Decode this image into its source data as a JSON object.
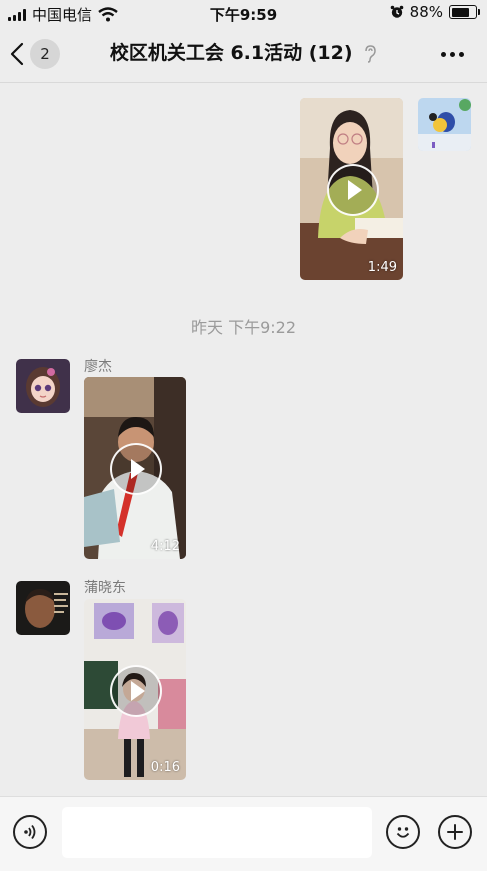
{
  "status_bar": {
    "carrier": "中国电信",
    "time": "下午9:59",
    "battery_text": "88%",
    "battery_level": 0.88,
    "icons": [
      "signal-icon",
      "wifi-icon",
      "alarm-icon",
      "battery-icon"
    ]
  },
  "nav": {
    "back_icon": "chevron-left-icon",
    "unread_count": "2",
    "title": "校区机关工会 6.1活动 (12)",
    "ear_icon": "earpiece-icon",
    "more_icon": "more-icon"
  },
  "messages": [
    {
      "type": "video",
      "side": "right",
      "duration": "1:49",
      "icon": "play-icon"
    },
    {
      "type": "timestamp",
      "text": "昨天 下午9:22"
    },
    {
      "type": "video",
      "side": "left",
      "sender": "廖杰",
      "duration": "4:12",
      "icon": "play-icon"
    },
    {
      "type": "video",
      "side": "left",
      "sender": "蒲晓东",
      "duration": "0:16",
      "icon": "play-icon"
    }
  ],
  "input_bar": {
    "voice_icon": "voice-icon",
    "text_value": "",
    "emoji_icon": "emoji-icon",
    "plus_icon": "plus-icon"
  },
  "colors": {
    "background": "#ededed",
    "input_bar": "#f6f6f6",
    "timestamp": "#9b9b9b",
    "sender_name": "#7a7a7a"
  }
}
